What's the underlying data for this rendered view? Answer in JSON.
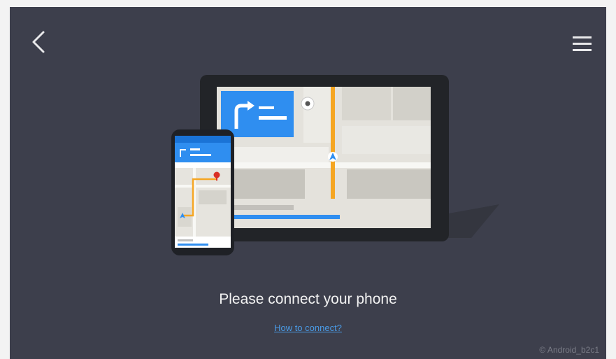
{
  "header": {
    "back_icon": "chevron-left-icon",
    "menu_icon": "hamburger-menu-icon"
  },
  "main": {
    "message": "Please connect your phone",
    "help_link": "How to connect?"
  },
  "watermark": "© Android_b2c1",
  "colors": {
    "background": "#3d3f4c",
    "accent_blue": "#2f8ef0",
    "route_orange": "#f5a623",
    "text": "#f2f2f2"
  }
}
